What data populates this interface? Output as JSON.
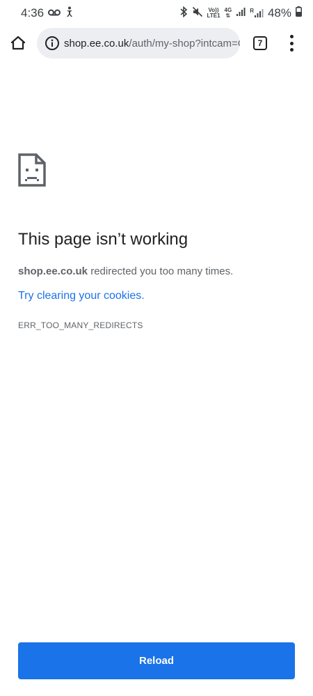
{
  "status_bar": {
    "time": "4:36",
    "icons_left": [
      "voicemail-icon",
      "accessibility-icon"
    ],
    "icons_right": [
      "bluetooth-icon",
      "mute-icon",
      "volte-icon",
      "4g-icon",
      "signal-icon",
      "signal-roaming-icon",
      "battery-icon"
    ],
    "volte_top": "Vo))",
    "volte_bottom": "LTE1",
    "net_label": "4G",
    "roaming_label": "R",
    "battery": "48%"
  },
  "toolbar": {
    "url_host": "shop.ee.co.uk",
    "url_path": "/auth/my-shop?intcam=C",
    "tab_count": "7"
  },
  "error": {
    "title": "This page isn’t working",
    "host": "shop.ee.co.uk",
    "message": " redirected you too many times.",
    "suggestion": "Try clearing your cookies",
    "suggestion_suffix": ".",
    "code": "ERR_TOO_MANY_REDIRECTS"
  },
  "actions": {
    "reload_label": "Reload"
  },
  "colors": {
    "accent": "#1a73e8",
    "omnibox_bg": "#eceef1",
    "text_primary": "#202124",
    "text_secondary": "#5f6368"
  }
}
